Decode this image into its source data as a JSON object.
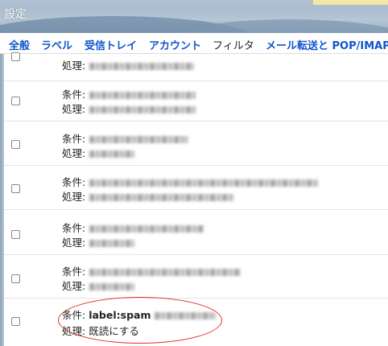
{
  "header": {
    "title": "設定"
  },
  "tabs": [
    {
      "label": "全般"
    },
    {
      "label": "ラベル"
    },
    {
      "label": "受信トレイ"
    },
    {
      "label": "アカウント"
    },
    {
      "label": "フィルタ"
    },
    {
      "label": "メール転送と POP/IMAP"
    }
  ],
  "labels": {
    "condition": "条件:",
    "action": "処理:"
  },
  "last_filter": {
    "condition_value": "label:spam",
    "action_value": "既読にする"
  }
}
